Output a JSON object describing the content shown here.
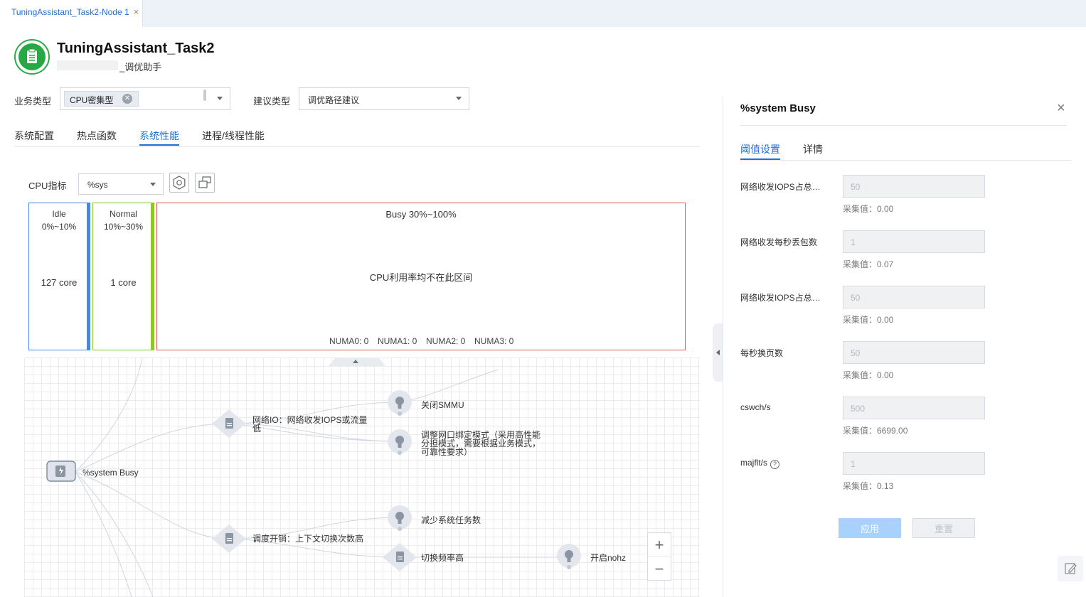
{
  "window_tab": {
    "label": "TuningAssistant_Task2-Node 1",
    "close": "×"
  },
  "header": {
    "title": "TuningAssistant_Task2",
    "subtitle": "_调优助手"
  },
  "filters": {
    "business_label": "业务类型",
    "business_value": "CPU密集型",
    "advice_label": "建议类型",
    "advice_value": "调优路径建议"
  },
  "tabs": [
    {
      "label": "系统配置"
    },
    {
      "label": "热点函数"
    },
    {
      "label": "系统性能",
      "active": true
    },
    {
      "label": "进程/线程性能"
    }
  ],
  "metric": {
    "label": "CPU指标",
    "value": "%sys"
  },
  "ranges": {
    "idle": {
      "name": "Idle",
      "range": "0%~10%",
      "count": "127 core",
      "color": "#4a86e8"
    },
    "normal": {
      "name": "Normal",
      "range": "10%~30%",
      "count": "1 core",
      "color": "#8ac926"
    },
    "busy": {
      "name": "Busy 30%~100%",
      "message": "CPU利用率均不在此区间",
      "color": "#e05757"
    },
    "numa": [
      "NUMA0: 0",
      "NUMA1: 0",
      "NUMA2: 0",
      "NUMA3: 0"
    ]
  },
  "tree": {
    "root": "%system Busy",
    "n1": "网络IO：网络收发IOPS或流量低",
    "s1": "关闭SMMU",
    "s2": "调整网口绑定模式（采用高性能分担模式，需要根据业务模式，可靠性要求）",
    "n2": "调度开销：上下文切换次数高",
    "s3": "减少系统任务数",
    "n3": "切换频率高",
    "s4": "开启nohz"
  },
  "zoom": {
    "in": "+",
    "out": "−"
  },
  "panel": {
    "title": "%system Busy",
    "close": "×",
    "tabs": [
      {
        "label": "阈值设置",
        "active": true
      },
      {
        "label": "详情"
      }
    ],
    "fields": [
      {
        "label": "网络收发IOPS占总带宽比例",
        "value": "50",
        "collected": "采集值：0.00"
      },
      {
        "label": "网络收发每秒丢包数",
        "value": "1",
        "collected": "采集值：0.07"
      },
      {
        "label": "网络收发IOPS占总带宽比例",
        "value": "50",
        "collected": "采集值：0.00"
      },
      {
        "label": "每秒换页数",
        "value": "50",
        "collected": "采集值：0.00"
      },
      {
        "label": "cswch/s",
        "value": "500",
        "collected": "采集值：6699.00"
      },
      {
        "label": "majflt/s",
        "value": "1",
        "collected": "采集值：0.13",
        "help": "?"
      }
    ],
    "apply": "应用",
    "reset": "重置"
  }
}
